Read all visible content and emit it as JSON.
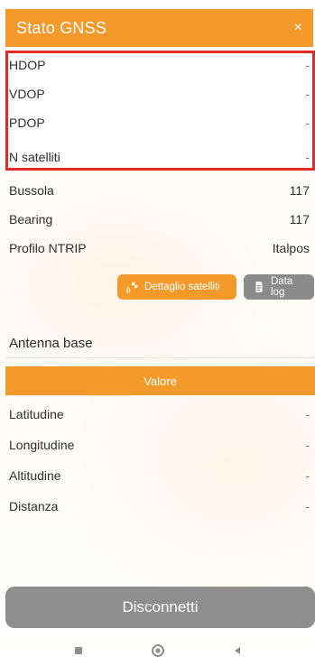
{
  "header": {
    "title": "Stato GNSS",
    "close_icon": "×"
  },
  "gnss_metrics": [
    {
      "label": "HDOP",
      "value": "-"
    },
    {
      "label": "VDOP",
      "value": "-"
    },
    {
      "label": "PDOP",
      "value": "-"
    },
    {
      "label": "N satelliti",
      "value": "-"
    }
  ],
  "other_metrics": [
    {
      "label": "Bussola",
      "value": "117"
    },
    {
      "label": "Bearing",
      "value": "117"
    },
    {
      "label": "Profilo NTRIP",
      "value": "Italpos"
    }
  ],
  "buttons": {
    "satellites_label": "Dettaglio satelliti",
    "datalog_label": "Data log"
  },
  "antenna": {
    "section_title": "Antenna base",
    "value_header": "Valore",
    "rows": [
      {
        "label": "Latitudine",
        "value": "-"
      },
      {
        "label": "Longitudine",
        "value": "-"
      },
      {
        "label": "Altitudine",
        "value": "-"
      },
      {
        "label": "Distanza",
        "value": "-"
      }
    ]
  },
  "actions": {
    "disconnect_label": "Disconnetti"
  },
  "colors": {
    "accent": "#f39a2a",
    "highlight": "#e22a2a",
    "button_gray": "#8b8b8b"
  },
  "icons": {
    "satellites": "satellite-icon",
    "datalog": "document-icon",
    "nav_recent": "square-icon",
    "nav_home": "circle-icon",
    "nav_back": "triangle-back-icon"
  }
}
